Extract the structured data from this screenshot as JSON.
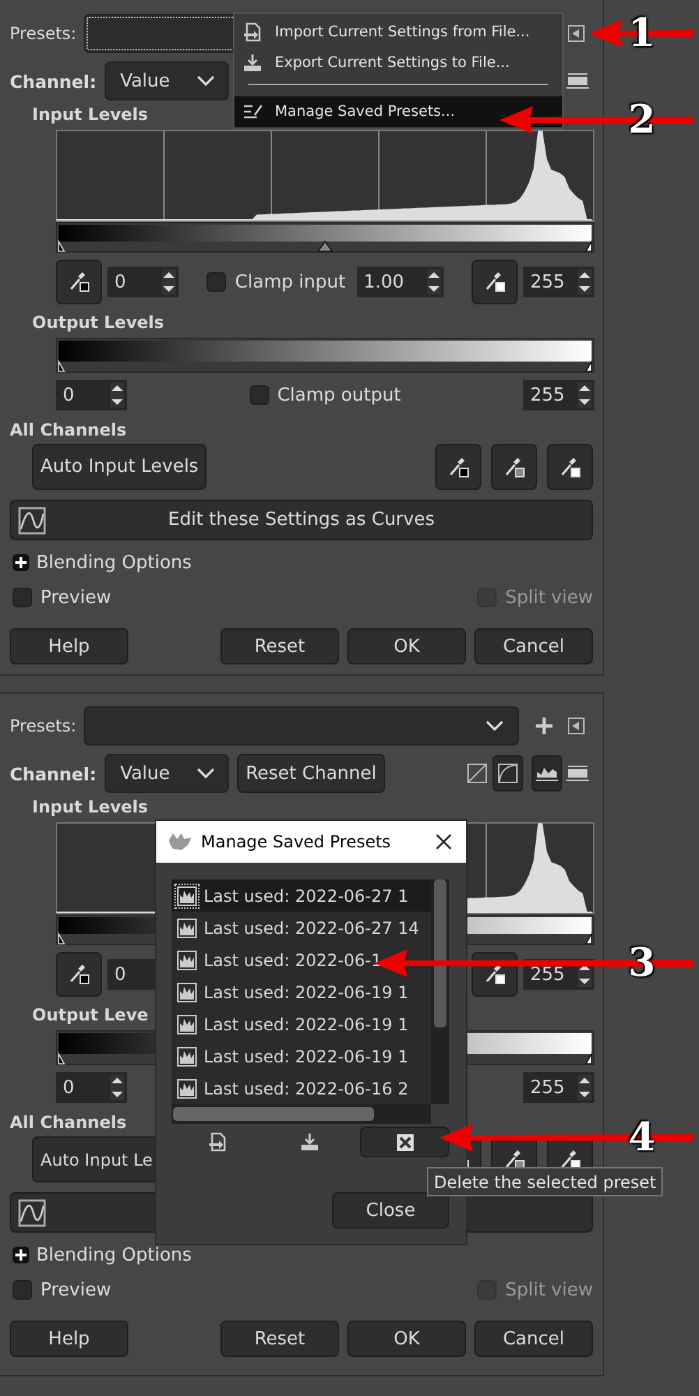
{
  "panels": [
    {
      "presets": {
        "label": "Presets:",
        "focused": true,
        "chevron": false
      },
      "preset_buttons": [
        {
          "kind": "menu"
        }
      ],
      "channel": {
        "label": "Channel:",
        "value": "Value"
      },
      "scale_buttons": [
        {
          "kind": "hist-log",
          "selected": false
        }
      ],
      "input_levels": {
        "title": "Input Levels",
        "handles": [
          {
            "level": 0
          },
          {
            "level": 0.5
          },
          {
            "level": 1
          }
        ],
        "low": "0",
        "clamp": {
          "label": "Clamp input",
          "checked": false
        },
        "gamma": "1.00",
        "high": "255"
      },
      "output_levels": {
        "title": "Output Levels",
        "handles": [
          {
            "level": 0
          },
          {
            "level": 1
          }
        ],
        "low": "0",
        "clamp": {
          "label": "Clamp output",
          "checked": false
        },
        "high": "255"
      },
      "all_channels": {
        "title": "All Channels",
        "auto_button": "Auto Input Levels"
      },
      "curves_button": {
        "kind": "curves",
        "label": "Edit these Settings as Curves"
      },
      "blending": {
        "label": "Blending Options",
        "expanded": false
      },
      "preview": {
        "label": "Preview",
        "checked": false
      },
      "split_view": {
        "label": "Split view",
        "checked": false,
        "disabled": true
      },
      "buttons": [
        "Help",
        "Reset",
        "OK",
        "Cancel"
      ],
      "menu": {
        "items": [
          {
            "kind": "import",
            "label": "Import Current Settings from File...",
            "selected": false
          },
          {
            "kind": "export",
            "label": "Export Current Settings to File...",
            "selected": false
          },
          {
            "kind": "separator"
          },
          {
            "kind": "manage",
            "label": "Manage Saved Presets...",
            "selected": true
          }
        ]
      }
    },
    {
      "presets": {
        "label": "Presets:",
        "focused": false,
        "chevron": true
      },
      "preset_buttons": [
        {
          "kind": "add"
        },
        {
          "kind": "menu"
        }
      ],
      "channel": {
        "label": "Channel:",
        "value": "Value"
      },
      "reset_channel": "Reset Channel",
      "scale_buttons": [
        {
          "kind": "curve-linear",
          "selected": false
        },
        {
          "kind": "curve-log",
          "selected": true
        },
        {
          "kind": "hist-linear",
          "selected": true
        },
        {
          "kind": "hist-log",
          "selected": false
        }
      ],
      "input_levels": {
        "title": "Input Levels",
        "handles": [
          {
            "level": 0
          },
          {
            "level": 1
          }
        ],
        "low": "0",
        "high": "255"
      },
      "output_levels": {
        "title": "Output Leve",
        "handles": [
          {
            "level": 0
          },
          {
            "level": 1
          }
        ],
        "low": "0",
        "high": "255"
      },
      "all_channels": {
        "title": "All Channels",
        "auto_button": "Auto Input Le"
      },
      "curves_button": {
        "kind": "curves"
      },
      "blending": {
        "label": "Blending Options",
        "expanded": false
      },
      "preview": {
        "label": "Preview",
        "checked": false
      },
      "split_view": {
        "label": "Split view",
        "checked": false,
        "disabled": true
      },
      "buttons": [
        "Help",
        "Reset",
        "OK",
        "Cancel"
      ],
      "presets_dialog": {
        "title": "Manage Saved Presets",
        "presets": [
          {
            "label": "Last used: 2022-06-27 1",
            "selected": true
          },
          {
            "label": "Last used: 2022-06-27 14",
            "selected": false
          },
          {
            "label": "Last used: 2022-06-1",
            "selected": false
          },
          {
            "label": "Last used: 2022-06-19 1",
            "selected": false
          },
          {
            "label": "Last used: 2022-06-19 1",
            "selected": false
          },
          {
            "label": "Last used: 2022-06-19 1",
            "selected": false
          },
          {
            "label": "Last used: 2022-06-16 2",
            "selected": false
          }
        ],
        "tools": [
          {
            "kind": "import"
          },
          {
            "kind": "export"
          },
          {
            "kind": "delete"
          }
        ],
        "close_button": "Close",
        "tooltip": "Delete the selected preset"
      }
    }
  ],
  "annotations": [
    {
      "number": "1"
    },
    {
      "number": "2"
    },
    {
      "number": "3"
    },
    {
      "number": "4"
    }
  ]
}
